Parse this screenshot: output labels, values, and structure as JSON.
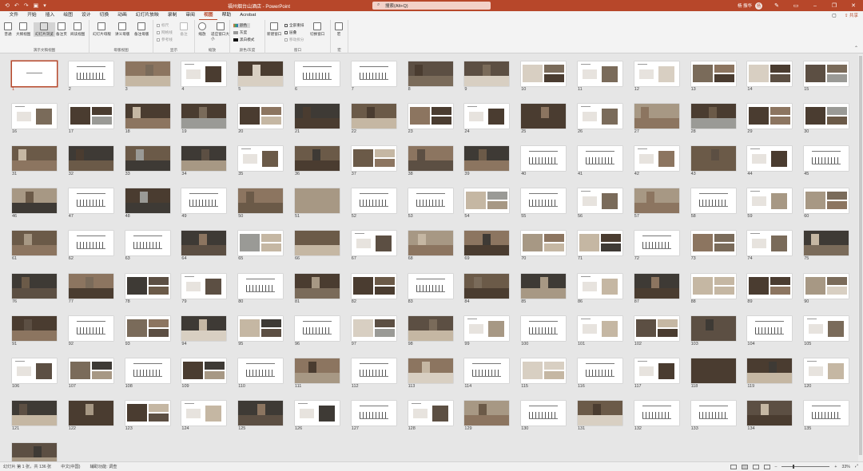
{
  "titlebar": {
    "title": "福州烟台山酒店 - PowerPoint",
    "search_placeholder": "搜索(Alt+Q)",
    "user": "杨 振华",
    "user_initial": "杨"
  },
  "tabs": [
    "文件",
    "开始",
    "插入",
    "绘图",
    "设计",
    "切换",
    "动画",
    "幻灯片放映",
    "录制",
    "审阅",
    "视图",
    "帮助",
    "Acrobat"
  ],
  "active_tab": "视图",
  "share_label": "共享",
  "ribbon": {
    "presentation_views": {
      "label": "演示文稿视图",
      "buttons": [
        "普通",
        "大纲视图",
        "幻灯片浏览",
        "备注页",
        "阅读视图"
      ]
    },
    "master_views": {
      "label": "母版视图",
      "buttons": [
        "幻灯片母版",
        "讲义母版",
        "备注母版"
      ]
    },
    "show": {
      "label": "显示",
      "items": [
        "标尺",
        "网格线",
        "参考线"
      ],
      "notes": "备注"
    },
    "zoom": {
      "label": "缩放",
      "buttons": [
        "缩放",
        "适应窗口大小"
      ]
    },
    "color": {
      "label": "颜色/灰度",
      "items": [
        "颜色",
        "灰度",
        "黑白模式"
      ]
    },
    "window": {
      "label": "窗口",
      "new_window": "新建窗口",
      "items": [
        "全部重排",
        "层叠",
        "移动拆分"
      ],
      "switch": "切换窗口"
    },
    "macro": {
      "label": "宏",
      "button": "宏"
    }
  },
  "slide_count": 136,
  "selected_slide": 1,
  "status": {
    "slide_info": "幻灯片 第 1 张，共 136 张",
    "language": "中文(中国)",
    "accessibility": "辅助功能: 调查",
    "zoom": "33%"
  },
  "colors": {
    "accent": "#b7472a",
    "photo": [
      "#4a3c30",
      "#6b5a48",
      "#8c7560",
      "#a79884",
      "#3e3a35",
      "#5c4f43",
      "#7a6b5a",
      "#c5b7a3",
      "#9a9a96",
      "#d8cfc2"
    ]
  }
}
